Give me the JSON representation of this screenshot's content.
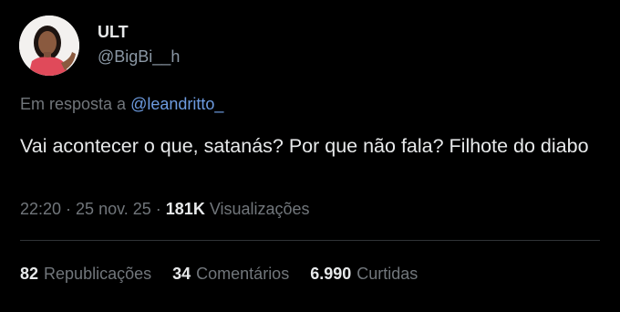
{
  "author": {
    "display_name": "ULT",
    "handle": "@BigBi__h"
  },
  "reply": {
    "prefix": "Em resposta a ",
    "mention": "@leandritto_"
  },
  "tweet": {
    "text": "Vai acontecer o que, satanás? Por que não fala? Filhote do diabo"
  },
  "meta": {
    "time": "22:20",
    "sep1": " · ",
    "date": "25 nov. 25",
    "sep2": " · ",
    "views_count": "181K",
    "views_label": " Visualizações"
  },
  "stats": {
    "reposts_count": "82",
    "reposts_label": "Republicações",
    "comments_count": "34",
    "comments_label": "Comentários",
    "likes_count": "6.990",
    "likes_label": "Curtidas"
  },
  "colors": {
    "background": "#000000",
    "text": "#e7e9ea",
    "secondary": "#71767b",
    "link": "#6d9be0",
    "avatar_top": "#e04a5a",
    "divider": "#2f3336"
  },
  "icons": {
    "avatar": "profile-photo"
  }
}
